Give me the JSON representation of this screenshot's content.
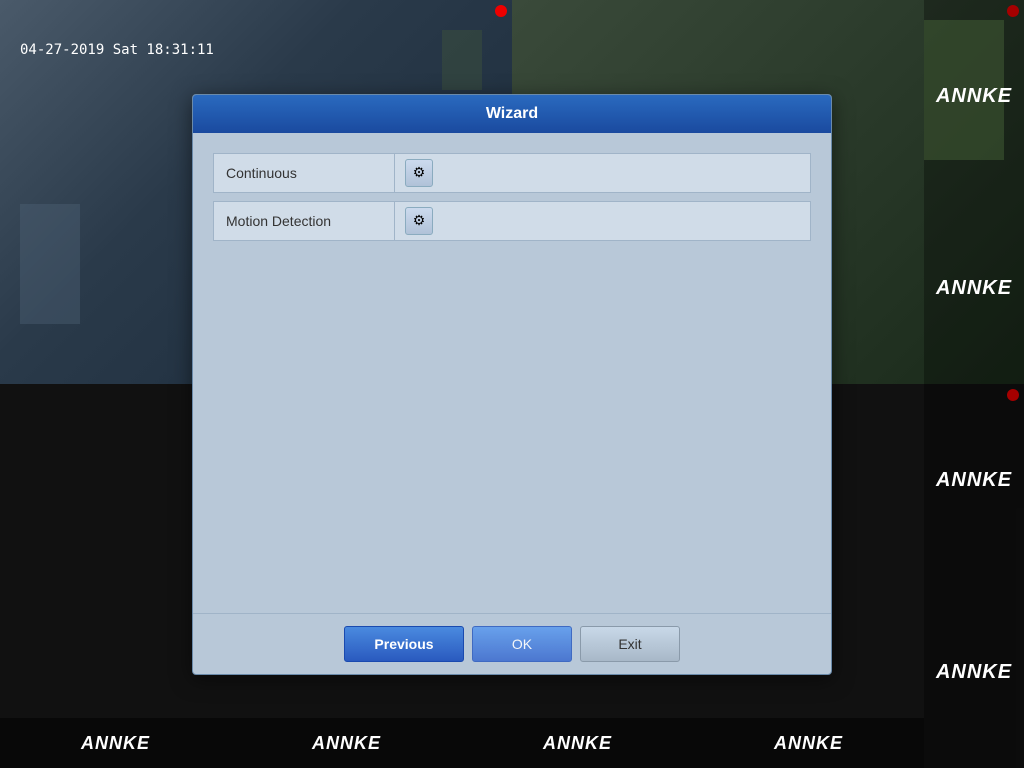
{
  "timestamp": "04-27-2019 Sat 18:31:11",
  "brand": "ANNKE",
  "cameras": {
    "top_left_bg": "dark-room",
    "top_right_bg": "green-tinted",
    "bottom_left_bg": "dark",
    "bottom_right_bg": "dark"
  },
  "dialog": {
    "title": "Wizard",
    "rows": [
      {
        "label": "Continuous",
        "icon": "gear"
      },
      {
        "label": "Motion Detection",
        "icon": "gear"
      }
    ]
  },
  "buttons": {
    "previous": "Previous",
    "ok": "OK",
    "exit": "Exit"
  },
  "annke_logos": [
    "ANNKE",
    "ANNKE",
    "ANNKE",
    "ANNKE"
  ],
  "annke_bottom": [
    "ANNKE",
    "ANNKE",
    "ANNKE",
    "ANNKE"
  ]
}
